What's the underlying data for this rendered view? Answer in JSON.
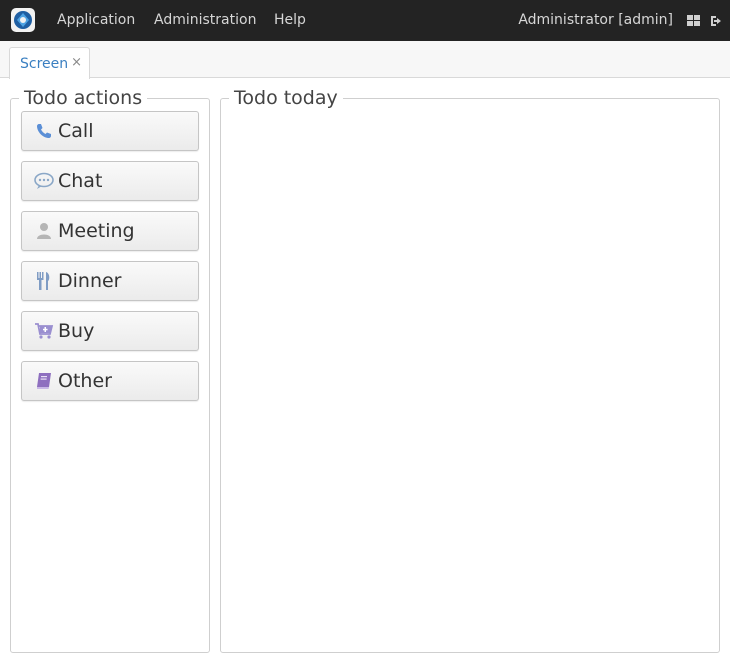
{
  "topbar": {
    "menu": [
      {
        "label": "Application"
      },
      {
        "label": "Administration"
      },
      {
        "label": "Help"
      }
    ],
    "user_label": "Administrator [admin]"
  },
  "tabs": [
    {
      "label": "Screen",
      "close_glyph": "×"
    }
  ],
  "todo_actions": {
    "title": "Todo actions",
    "buttons": [
      {
        "label": "Call",
        "icon": "phone-icon",
        "color": "#5b8fd6"
      },
      {
        "label": "Chat",
        "icon": "chat-bubble-icon",
        "color": "#8aa7c7"
      },
      {
        "label": "Meeting",
        "icon": "person-icon",
        "color": "#b5b5b5"
      },
      {
        "label": "Dinner",
        "icon": "fork-knife-icon",
        "color": "#7f9cc4"
      },
      {
        "label": "Buy",
        "icon": "cart-icon",
        "color": "#9a8fd0"
      },
      {
        "label": "Other",
        "icon": "book-icon",
        "color": "#8e6fbf"
      }
    ]
  },
  "todo_today": {
    "title": "Todo today"
  },
  "colors": {
    "topbar_bg": "#232323",
    "tab_accent": "#3a7fc1"
  }
}
